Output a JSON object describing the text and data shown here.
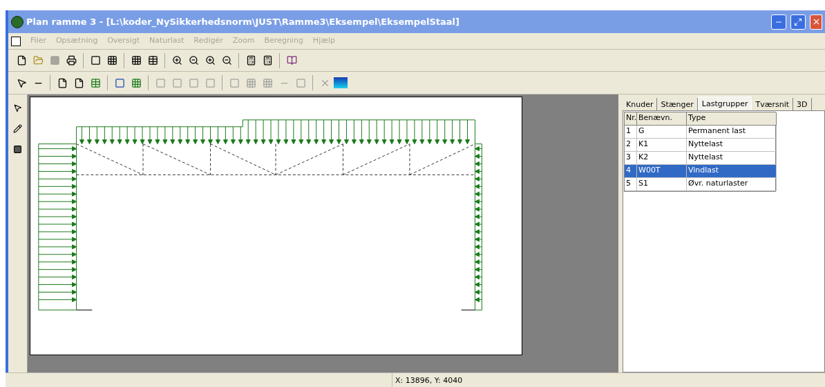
{
  "window": {
    "title": "Plan ramme 3 - [L:\\koder_NySikkerhedsnorm\\JUST\\Ramme3\\Eksempel\\EksempelStaal]"
  },
  "menu": [
    {
      "label": "Filer",
      "disabled": true
    },
    {
      "label": "Opsætning",
      "disabled": true
    },
    {
      "label": "Oversigt",
      "disabled": true
    },
    {
      "label": "Naturlast",
      "disabled": true
    },
    {
      "label": "Redigér",
      "disabled": true
    },
    {
      "label": "Zoom",
      "disabled": true
    },
    {
      "label": "Beregning",
      "disabled": true
    },
    {
      "label": "Hjælp",
      "disabled": true
    }
  ],
  "tabs": [
    {
      "label": "Knuder",
      "selected": false
    },
    {
      "label": "Stænger",
      "selected": false
    },
    {
      "label": "Lastgrupper",
      "selected": true
    },
    {
      "label": "Tværsnit",
      "selected": false
    },
    {
      "label": "3D",
      "selected": false
    }
  ],
  "table": {
    "columns": [
      "Nr.",
      "Benævn.",
      "Type"
    ],
    "rows": [
      {
        "nr": "1",
        "name": "G",
        "type": "Permanent last",
        "selected": false
      },
      {
        "nr": "2",
        "name": "K1",
        "type": "Nyttelast",
        "selected": false
      },
      {
        "nr": "3",
        "name": "K2",
        "type": "Nyttelast",
        "selected": false
      },
      {
        "nr": "4",
        "name": "W00T",
        "type": "Vindlast",
        "selected": true
      },
      {
        "nr": "5",
        "name": "S1",
        "type": "Øvr. naturlaster",
        "selected": false
      }
    ]
  },
  "status_bar": {
    "coordinates": "X: 13896, Y: 4040"
  }
}
